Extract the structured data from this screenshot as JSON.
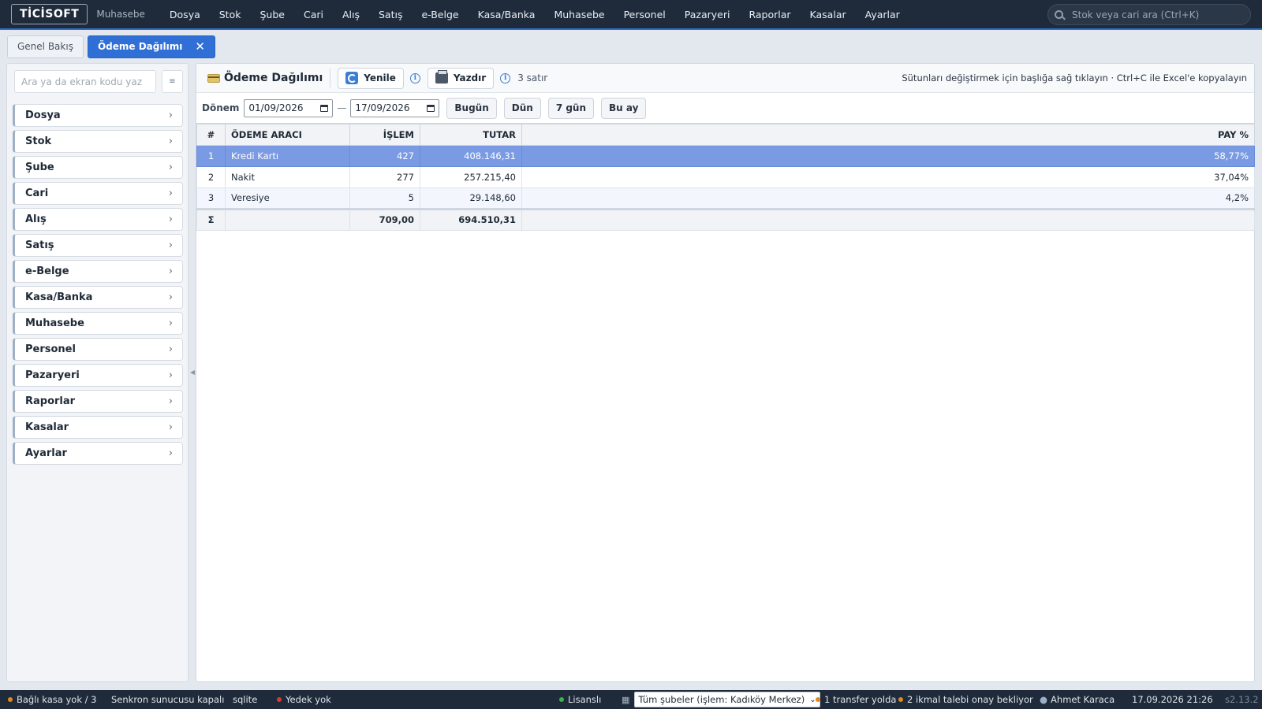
{
  "app": {
    "logo": "TİCİSOFT",
    "subtitle": "Muhasebe",
    "menu": [
      "Dosya",
      "Stok",
      "Şube",
      "Cari",
      "Alış",
      "Satış",
      "e-Belge",
      "Kasa/Banka",
      "Muhasebe",
      "Personel",
      "Pazaryeri",
      "Raporlar",
      "Kasalar",
      "Ayarlar"
    ],
    "search_placeholder": "Stok veya cari ara (Ctrl+K)"
  },
  "tabs": [
    {
      "label": "Genel Bakış",
      "active": false
    },
    {
      "label": "Ödeme Dağılımı",
      "active": true,
      "close": "✕"
    }
  ],
  "sidebar": {
    "search_placeholder": "Ara ya da ekran kodu yaz",
    "grid_icon": "≡",
    "items": [
      "Dosya",
      "Stok",
      "Şube",
      "Cari",
      "Alış",
      "Satış",
      "e-Belge",
      "Kasa/Banka",
      "Muhasebe",
      "Personel",
      "Pazaryeri",
      "Raporlar",
      "Kasalar",
      "Ayarlar"
    ]
  },
  "panel": {
    "title": "Ödeme Dağılımı",
    "refresh_label": "Yenile",
    "print_label": "Yazdır",
    "row_count": "3 satır",
    "hint": "Sütunları değiştirmek için başlığa sağ tıklayın · Ctrl+C ile Excel'e kopyalayın"
  },
  "filter": {
    "label": "Dönem",
    "date_from": "01/09/2026",
    "date_to": "17/09/2026",
    "dash": "—",
    "quick": [
      "Bugün",
      "Dün",
      "7 gün",
      "Bu ay"
    ]
  },
  "table": {
    "headers": [
      "#",
      "ÖDEME ARACI",
      "İŞLEM",
      "TUTAR",
      "PAY %"
    ],
    "rows": [
      [
        "1",
        "Kredi Kartı",
        "427",
        "408.146,31",
        "58,77%"
      ],
      [
        "2",
        "Nakit",
        "277",
        "257.215,40",
        "37,04%"
      ],
      [
        "3",
        "Veresiye",
        "5",
        "29.148,60",
        "4,2%"
      ]
    ],
    "selected_row": 0,
    "sum": [
      "Σ",
      "",
      "709,00",
      "694.510,31",
      ""
    ]
  },
  "status": {
    "kasa": "Bağlı kasa yok / 3",
    "sync": "Senkron sunucusu kapalı",
    "db": "sqlite",
    "backup": "Yedek yok",
    "license": "Lisanslı",
    "branch": "Tüm şubeler (işlem: Kadıköy Merkez)",
    "transfer": "1 transfer yolda",
    "ikmal": "2 ikmal talebi onay bekliyor",
    "user": "Ahmet Karaca",
    "datetime": "17.09.2026 21:26",
    "version": "s2.13.2"
  },
  "colors": {
    "topbar": "#1f2b3a",
    "accent": "#2f6fd6",
    "selected_row": "#7a9be3",
    "dot_orange": "#e08a1e",
    "dot_red": "#d83a3a",
    "dot_green": "#39b44a"
  }
}
